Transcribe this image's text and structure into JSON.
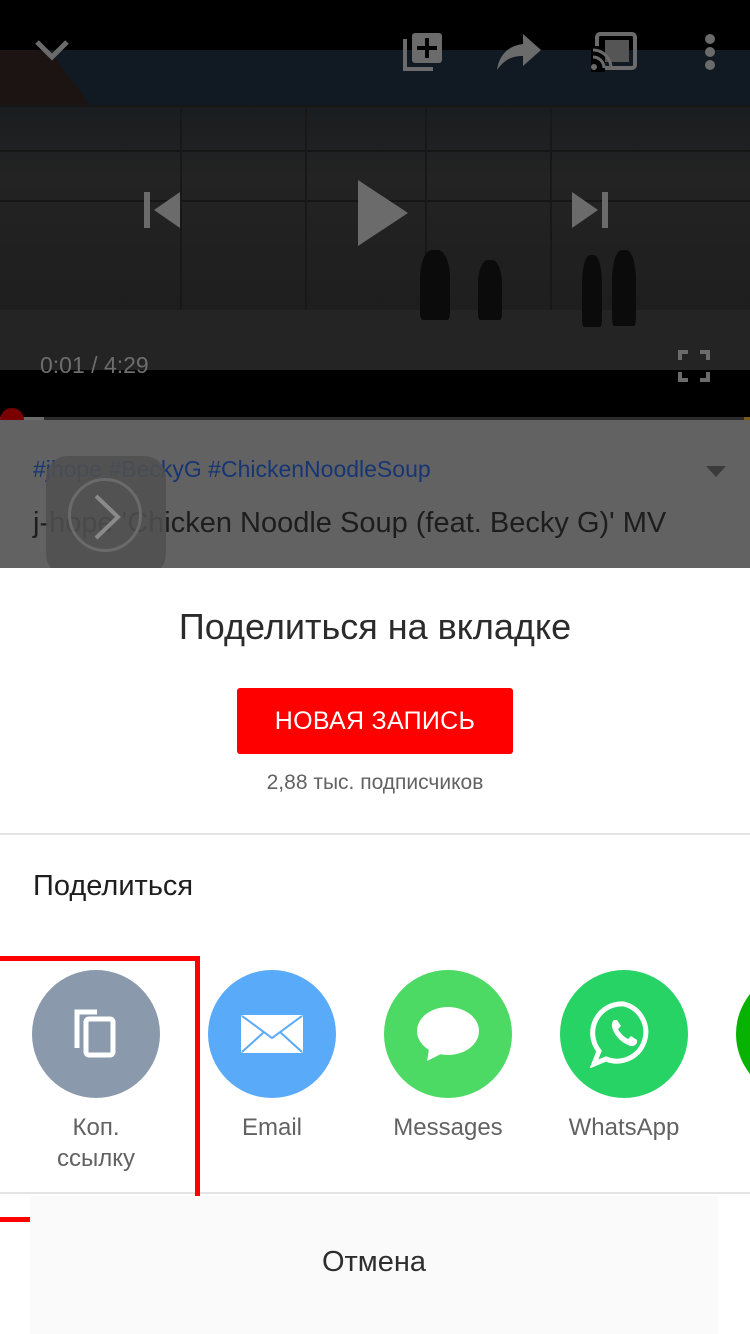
{
  "player": {
    "current_time": "0:01",
    "separator": " / ",
    "duration": "4:29",
    "progress_fraction": 0.004,
    "icons": {
      "minimize": "chevron-down-icon",
      "add_to_playlist": "playlist-add-icon",
      "share": "share-arrow-icon",
      "cast": "cast-icon",
      "more": "more-vert-icon",
      "previous": "skip-previous-icon",
      "play": "play-icon",
      "next": "skip-next-icon",
      "fullscreen": "fullscreen-icon"
    }
  },
  "video": {
    "hashtags": "#jhope #BeckyG #ChickenNoodleSoup",
    "title": "j-hope 'Chicken Noodle Soup (feat. Becky G)' MV"
  },
  "share_sheet": {
    "community_title": "Поделиться на вкладке",
    "new_post_label": "НОВАЯ ЗАПИСЬ",
    "subscribers": "2,88 тыс. подписчиков",
    "share_label": "Поделиться",
    "apps": [
      {
        "label_line1": "Коп.",
        "label_line2": "ссылку",
        "icon": "copy-link-icon",
        "color": "#8a99ab"
      },
      {
        "label_line1": "Email",
        "label_line2": "",
        "icon": "mail-icon",
        "color": "#5aaafa"
      },
      {
        "label_line1": "Messages",
        "label_line2": "",
        "icon": "message-bubble-icon",
        "color": "#4cd964"
      },
      {
        "label_line1": "WhatsApp",
        "label_line2": "",
        "icon": "whatsapp-icon",
        "color": "#28d366"
      },
      {
        "label_line1": "",
        "label_line2": "",
        "icon": "app-icon",
        "color": "#07b300"
      }
    ],
    "cancel_label": "Отмена"
  },
  "colors": {
    "accent_red": "#fe0000",
    "highlight_box": "#ff0000",
    "hashtag_blue": "#163572"
  }
}
